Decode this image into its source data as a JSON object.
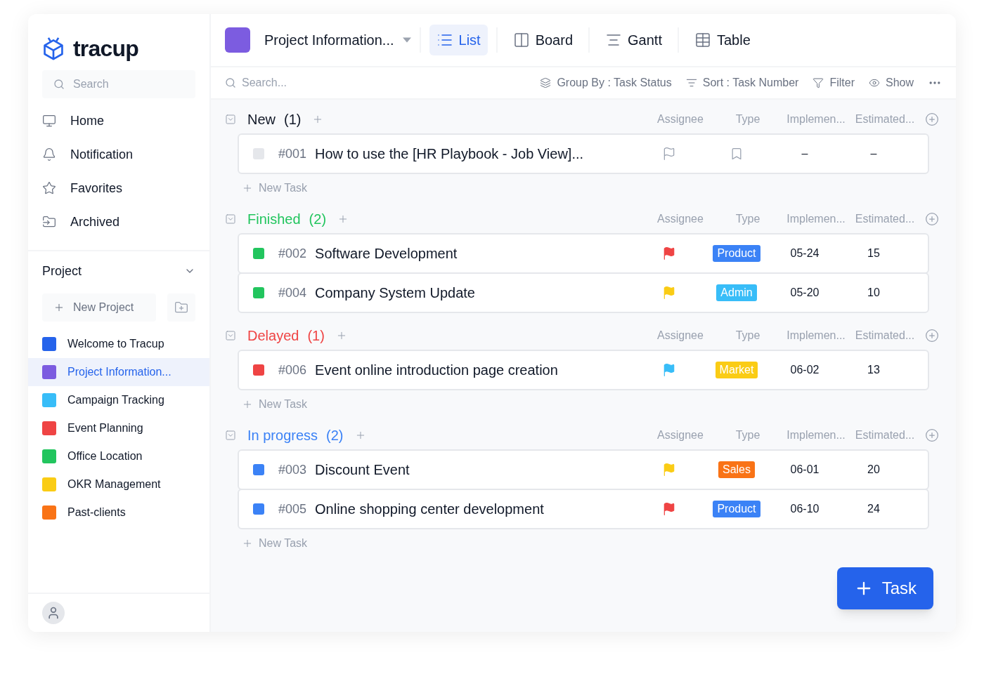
{
  "logo": {
    "text": "tracup"
  },
  "sidebar": {
    "search": {
      "placeholder": "Search"
    },
    "nav": [
      {
        "label": "Home",
        "kind": "home"
      },
      {
        "label": "Notification",
        "kind": "bell"
      },
      {
        "label": "Favorites",
        "kind": "star"
      },
      {
        "label": "Archived",
        "kind": "archive"
      }
    ],
    "project_header": {
      "label": "Project",
      "expanded": true
    },
    "new_project": "New Project",
    "projects": [
      {
        "name": "Welcome to Tracup",
        "color": "#2563eb",
        "selected": false
      },
      {
        "name": "Project Information...",
        "color": "#7c5ce0",
        "selected": true
      },
      {
        "name": "Campaign Tracking",
        "color": "#38bdf8",
        "selected": false
      },
      {
        "name": "Event Planning",
        "color": "#ef4444",
        "selected": false
      },
      {
        "name": "Office Location",
        "color": "#22c55e",
        "selected": false
      },
      {
        "name": "OKR Management",
        "color": "#facc15",
        "selected": false
      },
      {
        "name": "Past-clients",
        "color": "#f97316",
        "selected": false
      }
    ]
  },
  "topbar": {
    "project": {
      "name": "Project Information...",
      "color": "#7c5ce0"
    },
    "views": [
      {
        "label": "List",
        "kind": "list",
        "selected": true
      },
      {
        "label": "Board",
        "kind": "board",
        "selected": false
      },
      {
        "label": "Gantt",
        "kind": "gantt",
        "selected": false
      },
      {
        "label": "Table",
        "kind": "table",
        "selected": false
      }
    ]
  },
  "toolbar": {
    "search": {
      "placeholder": "Search..."
    },
    "group_by": "Group By : Task Status",
    "sort": "Sort : Task Number",
    "filter": "Filter",
    "show": "Show"
  },
  "groups": [
    {
      "name": "New",
      "count": "(1)",
      "color": "#111827",
      "columns": [
        "Assignee",
        "Type",
        "Implemen...",
        "Estimated..."
      ],
      "new_task": "New Task",
      "tasks": [
        {
          "number": "#001",
          "title": "How to use the [HR Playbook - Job View]...",
          "color": "#e5e7eb",
          "implementation": "–",
          "estimated": "–"
        }
      ]
    },
    {
      "name": "Finished",
      "count": "(2)",
      "color": "#22c55e",
      "columns": [
        "Assignee",
        "Type",
        "Implemen...",
        "Estimated..."
      ],
      "tasks": [
        {
          "number": "#002",
          "title": "Software Development",
          "color": "#22c55e",
          "flag": {
            "color": "#ef4444"
          },
          "type": {
            "label": "Product",
            "color": "#3b82f6"
          },
          "implementation": "05-24",
          "estimated": "15"
        },
        {
          "number": "#004",
          "title": "Company System Update",
          "color": "#22c55e",
          "flag": {
            "color": "#facc15"
          },
          "type": {
            "label": "Admin",
            "color": "#38bdf8"
          },
          "implementation": "05-20",
          "estimated": "10"
        }
      ]
    },
    {
      "name": "Delayed",
      "count": "(1)",
      "color": "#ef4444",
      "columns": [
        "Assignee",
        "Type",
        "Implemen...",
        "Estimated..."
      ],
      "new_task": "New Task",
      "tasks": [
        {
          "number": "#006",
          "title": "Event online introduction page creation",
          "color": "#ef4444",
          "flag": {
            "color": "#38bdf8"
          },
          "type": {
            "label": "Market",
            "color": "#facc15"
          },
          "implementation": "06-02",
          "estimated": "13"
        }
      ]
    },
    {
      "name": "In progress",
      "count": "(2)",
      "color": "#3b82f6",
      "columns": [
        "Assignee",
        "Type",
        "Implemen...",
        "Estimated..."
      ],
      "new_task": "New Task",
      "tasks": [
        {
          "number": "#003",
          "title": "Discount Event",
          "color": "#3b82f6",
          "flag": {
            "color": "#facc15"
          },
          "type": {
            "label": "Sales",
            "color": "#f97316"
          },
          "implementation": "06-01",
          "estimated": "20"
        },
        {
          "number": "#005",
          "title": "Online shopping center development",
          "color": "#3b82f6",
          "flag": {
            "color": "#ef4444"
          },
          "type": {
            "label": "Product",
            "color": "#3b82f6"
          },
          "implementation": "06-10",
          "estimated": "24"
        }
      ]
    }
  ],
  "fab": {
    "label": "Task"
  }
}
